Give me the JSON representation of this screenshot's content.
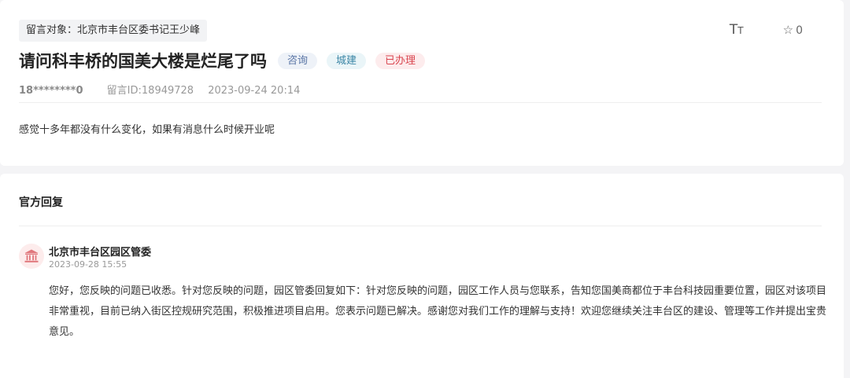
{
  "message": {
    "target": "留言对象：北京市丰台区委书记王少峰",
    "title": "请问科丰桥的国美大楼是烂尾了吗",
    "tags": [
      {
        "label": "咨询",
        "bg": "#eef2f8",
        "color": "#5a76a6"
      },
      {
        "label": "城建",
        "bg": "#eaf5f8",
        "color": "#3b86a6"
      },
      {
        "label": "已办理",
        "bg": "#fdeced",
        "color": "#d9454f"
      }
    ],
    "author": "18********0",
    "message_id": "留言ID:18949728",
    "datetime": "2023-09-24 20:14",
    "content": "感觉十多年都没有什么变化，如果有消息什么时候开业呢"
  },
  "toolbar": {
    "font_size_big": "T",
    "font_size_small": "T",
    "favorite_icon": "star-outline-icon",
    "favorite_count": "0"
  },
  "reply": {
    "section_title": "官方回复",
    "org_icon": "government-building-icon",
    "org_icon_color": "#e0777c",
    "org_name": "北京市丰台区园区管委",
    "date": "2023-09-28 15:55",
    "text": "您好，您反映的问题已收悉。针对您反映的问题，园区管委回复如下：针对您反映的问题，园区工作人员与您联系，告知您国美商都位于丰台科技园重要位置，园区对该项目非常重视，目前已纳入街区控规研究范围，积极推进项目启用。您表示问题已解决。感谢您对我们工作的理解与支持！欢迎您继续关注丰台区的建设、管理等工作并提出宝贵意见。"
  }
}
